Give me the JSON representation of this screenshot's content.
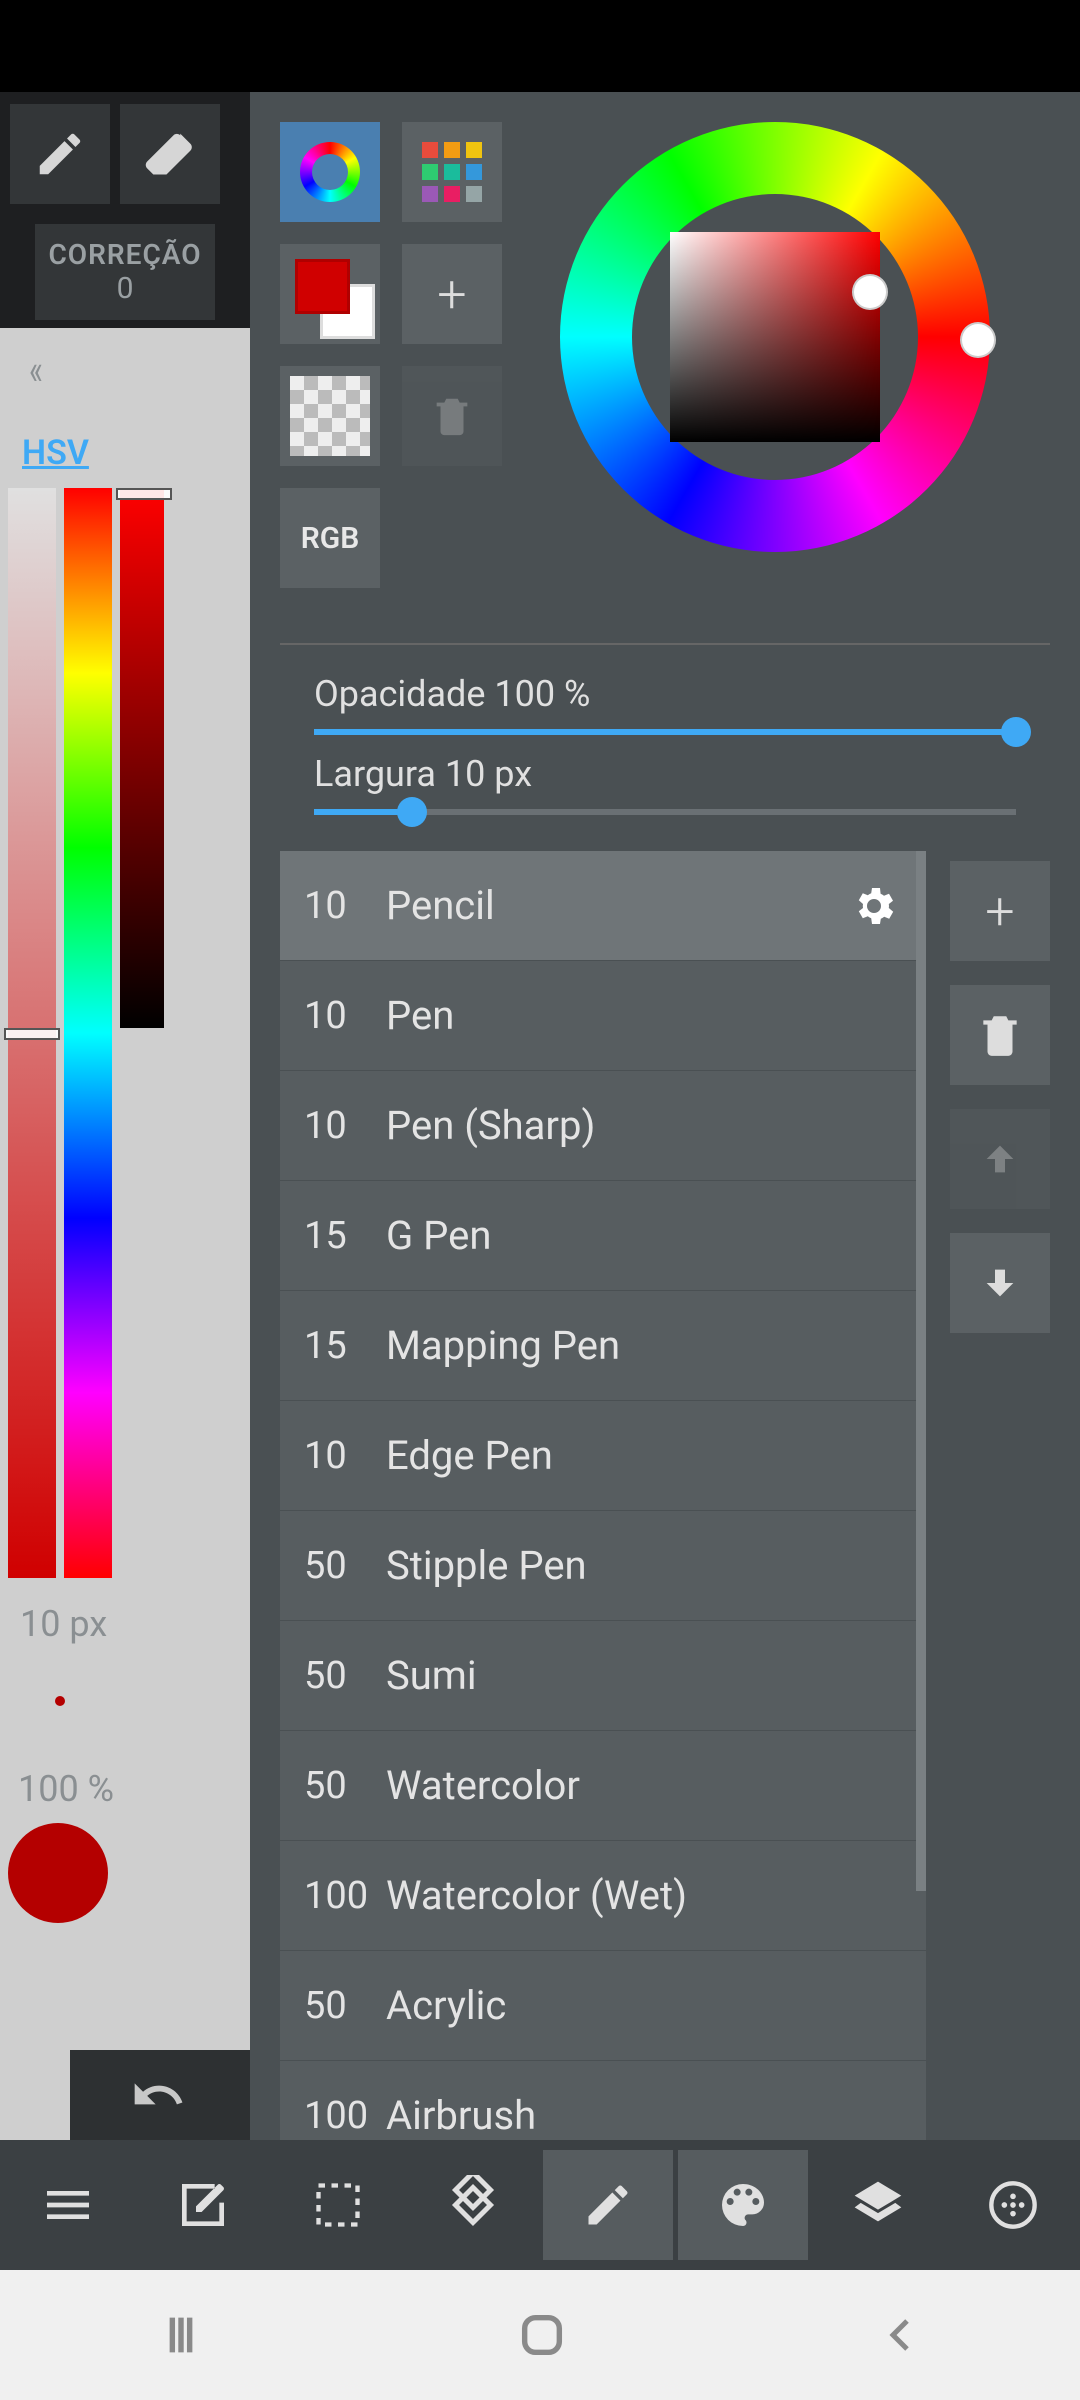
{
  "left": {
    "correction_label": "CORREÇÃO",
    "correction_value": "0",
    "mode_label": "HSV",
    "size_label": "10 px",
    "opacity_label": "100 %",
    "swatch_color": "#b40000"
  },
  "panel": {
    "rgb_label": "RGB",
    "opacity": {
      "label": "Opacidade 100 %",
      "percent": 100
    },
    "width": {
      "label": "Largura 10 px",
      "percent": 14
    }
  },
  "brushes": [
    {
      "size": "10",
      "name": "Pencil",
      "selected": true
    },
    {
      "size": "10",
      "name": "Pen",
      "selected": false
    },
    {
      "size": "10",
      "name": "Pen (Sharp)",
      "selected": false
    },
    {
      "size": "15",
      "name": "G Pen",
      "selected": false
    },
    {
      "size": "15",
      "name": "Mapping Pen",
      "selected": false
    },
    {
      "size": "10",
      "name": "Edge Pen",
      "selected": false
    },
    {
      "size": "50",
      "name": "Stipple Pen",
      "selected": false
    },
    {
      "size": "50",
      "name": "Sumi",
      "selected": false
    },
    {
      "size": "50",
      "name": "Watercolor",
      "selected": false
    },
    {
      "size": "100",
      "name": "Watercolor (Wet)",
      "selected": false
    },
    {
      "size": "50",
      "name": "Acrylic",
      "selected": false
    },
    {
      "size": "100",
      "name": "Airbrush",
      "selected": false
    }
  ]
}
